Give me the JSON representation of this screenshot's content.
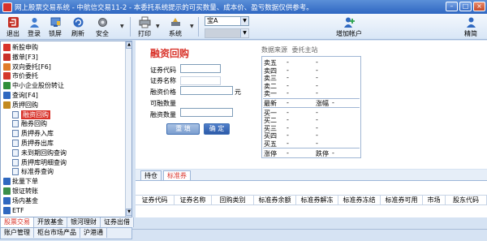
{
  "window": {
    "title": "网上股票交易系统 - 中航信交易11-2 - 本委托系统提示的可买数量、成本价、盈亏数据仅供参考。"
  },
  "toolbar": {
    "exit": "退出",
    "login": "登录",
    "lock": "锁屏",
    "refresh": "刷新",
    "security": "安全",
    "print": "打印",
    "system": "系统",
    "font_size": "宝A",
    "add_account": "增加帐户",
    "simple": "精简"
  },
  "tree": {
    "items": [
      {
        "label": "新股申购",
        "level": 0,
        "icon": "new-stock-icon"
      },
      {
        "label": "撤单[F3]",
        "level": 0,
        "icon": "cancel-order-icon"
      },
      {
        "label": "双向委托[F6]",
        "level": 0,
        "icon": "dual-order-icon"
      },
      {
        "label": "市价委托",
        "level": 0,
        "icon": "market-order-icon"
      },
      {
        "label": "中小企业股份转让",
        "level": 0,
        "icon": "sme-icon"
      },
      {
        "label": "查询[F4]",
        "level": 0,
        "icon": "query-icon"
      },
      {
        "label": "质押回购",
        "level": 0,
        "icon": "repo-folder-icon"
      },
      {
        "label": "融资回购",
        "level": 1,
        "selected": true
      },
      {
        "label": "融券回购",
        "level": 1
      },
      {
        "label": "质押券入库",
        "level": 1
      },
      {
        "label": "质押券出库",
        "level": 1
      },
      {
        "label": "未到期回购查询",
        "level": 1
      },
      {
        "label": "质押库明细查询",
        "level": 1
      },
      {
        "label": "标准券查询",
        "level": 1
      },
      {
        "label": "批量下单",
        "level": 0,
        "icon": "batch-order-icon"
      },
      {
        "label": "银证转账",
        "level": 0,
        "icon": "bank-transfer-icon"
      },
      {
        "label": "场内基金",
        "level": 0,
        "icon": "fund-icon"
      },
      {
        "label": "ETF",
        "level": 0,
        "icon": "etf-icon"
      }
    ]
  },
  "left_tabs_row1": [
    "股票交易",
    "开放基金",
    "银河理财",
    "证券出借"
  ],
  "left_tabs_row2": [
    "账户管理",
    "柜台市场产品",
    "沪港通"
  ],
  "form": {
    "title": "融资回购",
    "code_label": "证券代码",
    "name_label": "证券名称",
    "price_label": "融资价格",
    "price_unit": "元",
    "avail_label": "可融数量",
    "qty_label": "融资数量",
    "reset_button": "重 填",
    "confirm_button": "确 定"
  },
  "quote": {
    "source_label": "数据来源",
    "source_value": "委托主站",
    "sell": [
      {
        "name": "卖五",
        "price": "-",
        "vol": "-"
      },
      {
        "name": "卖四",
        "price": "-",
        "vol": "-"
      },
      {
        "name": "卖三",
        "price": "-",
        "vol": "-"
      },
      {
        "name": "卖二",
        "price": "-",
        "vol": "-"
      },
      {
        "name": "卖一",
        "price": "-",
        "vol": "-"
      }
    ],
    "last": {
      "name": "最新",
      "price": "-",
      "extra_label": "涨幅",
      "extra_value": "-"
    },
    "buy": [
      {
        "name": "买一",
        "price": "-",
        "vol": "-"
      },
      {
        "name": "买二",
        "price": "-",
        "vol": "-"
      },
      {
        "name": "买三",
        "price": "-",
        "vol": "-"
      },
      {
        "name": "买四",
        "price": "-",
        "vol": "-"
      },
      {
        "name": "买五",
        "price": "-",
        "vol": "-"
      }
    ],
    "limit": {
      "up_label": "涨停",
      "up_value": "-",
      "down_label": "跌停",
      "down_value": "-"
    }
  },
  "bottom_tabs": [
    "持仓",
    "标准券"
  ],
  "table": {
    "columns": [
      "证券代码",
      "证券名称",
      "回购类别",
      "标准券余额",
      "标准券解冻",
      "标准券冻结",
      "标准券可用",
      "市场",
      "股东代码"
    ]
  }
}
